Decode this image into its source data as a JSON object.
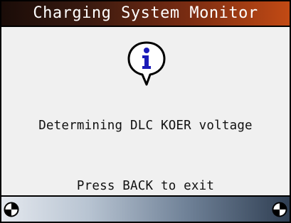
{
  "header": {
    "title": "Charging System Monitor"
  },
  "body": {
    "icon": "info-icon",
    "message": "Determining DLC KOER voltage",
    "hint": "Press BACK to exit"
  },
  "status_bar": {
    "left_indicator": "target-icon",
    "right_indicator": "target-icon"
  },
  "colors": {
    "title_bar_start": "#1a0c08",
    "title_bar_end": "#c24a14",
    "background": "#f0f0f0",
    "icon_fill": "#1b1bb8",
    "status_bar_start": "#e4e8ee",
    "status_bar_end": "#2f3e52"
  }
}
